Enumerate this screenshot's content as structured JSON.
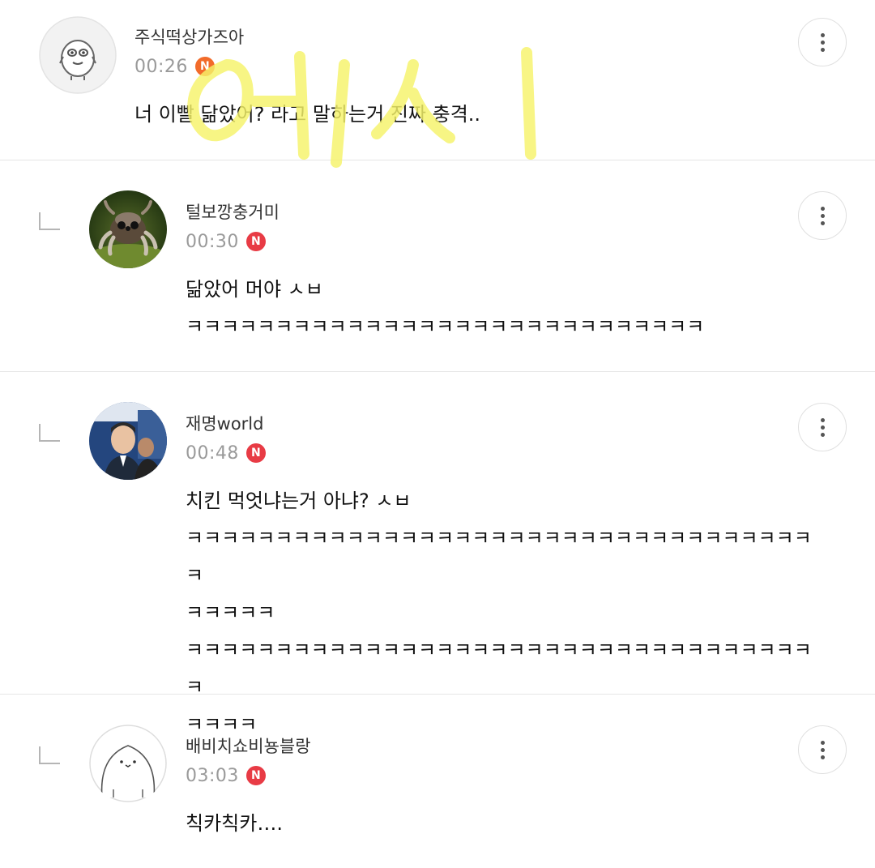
{
  "accent": {
    "badge_orange": "#f26b2a",
    "badge_red": "#e83b45",
    "watermark_yellow": "#f6f36a"
  },
  "comments": [
    {
      "author": "주식떡상가즈아",
      "time": "00:26",
      "badge": "N",
      "text": "너 이빨 닮았어? 라고 말하는거 진짜 충격..",
      "avatar": "character-avatar",
      "is_reply": false
    },
    {
      "author": "털보깡충거미",
      "time": "00:30",
      "badge": "N",
      "text": "닮았어 머야 ㅅㅂ\nㅋㅋㅋㅋㅋㅋㅋㅋㅋㅋㅋㅋㅋㅋㅋㅋㅋㅋㅋㅋㅋㅋㅋㅋㅋㅋㅋㅋㅋ",
      "avatar": "spider-photo-avatar",
      "is_reply": true
    },
    {
      "author": "재명world",
      "time": "00:48",
      "badge": "N",
      "text": "치킨 먹엇냐는거 아냐? ㅅㅂ\nㅋㅋㅋㅋㅋㅋㅋㅋㅋㅋㅋㅋㅋㅋㅋㅋㅋㅋㅋㅋㅋㅋㅋㅋㅋㅋㅋㅋㅋㅋㅋㅋㅋㅋㅋㅋ\nㅋㅋㅋㅋㅋ\nㅋㅋㅋㅋㅋㅋㅋㅋㅋㅋㅋㅋㅋㅋㅋㅋㅋㅋㅋㅋㅋㅋㅋㅋㅋㅋㅋㅋㅋㅋㅋㅋㅋㅋㅋㅋ\nㅋㅋㅋㅋ",
      "avatar": "person-photo-avatar",
      "is_reply": true
    },
    {
      "author": "배비치쇼비뇽블랑",
      "time": "03:03",
      "badge": "N",
      "text": "칙카칙카….",
      "avatar": "seal-drawing-avatar",
      "is_reply": true
    }
  ]
}
